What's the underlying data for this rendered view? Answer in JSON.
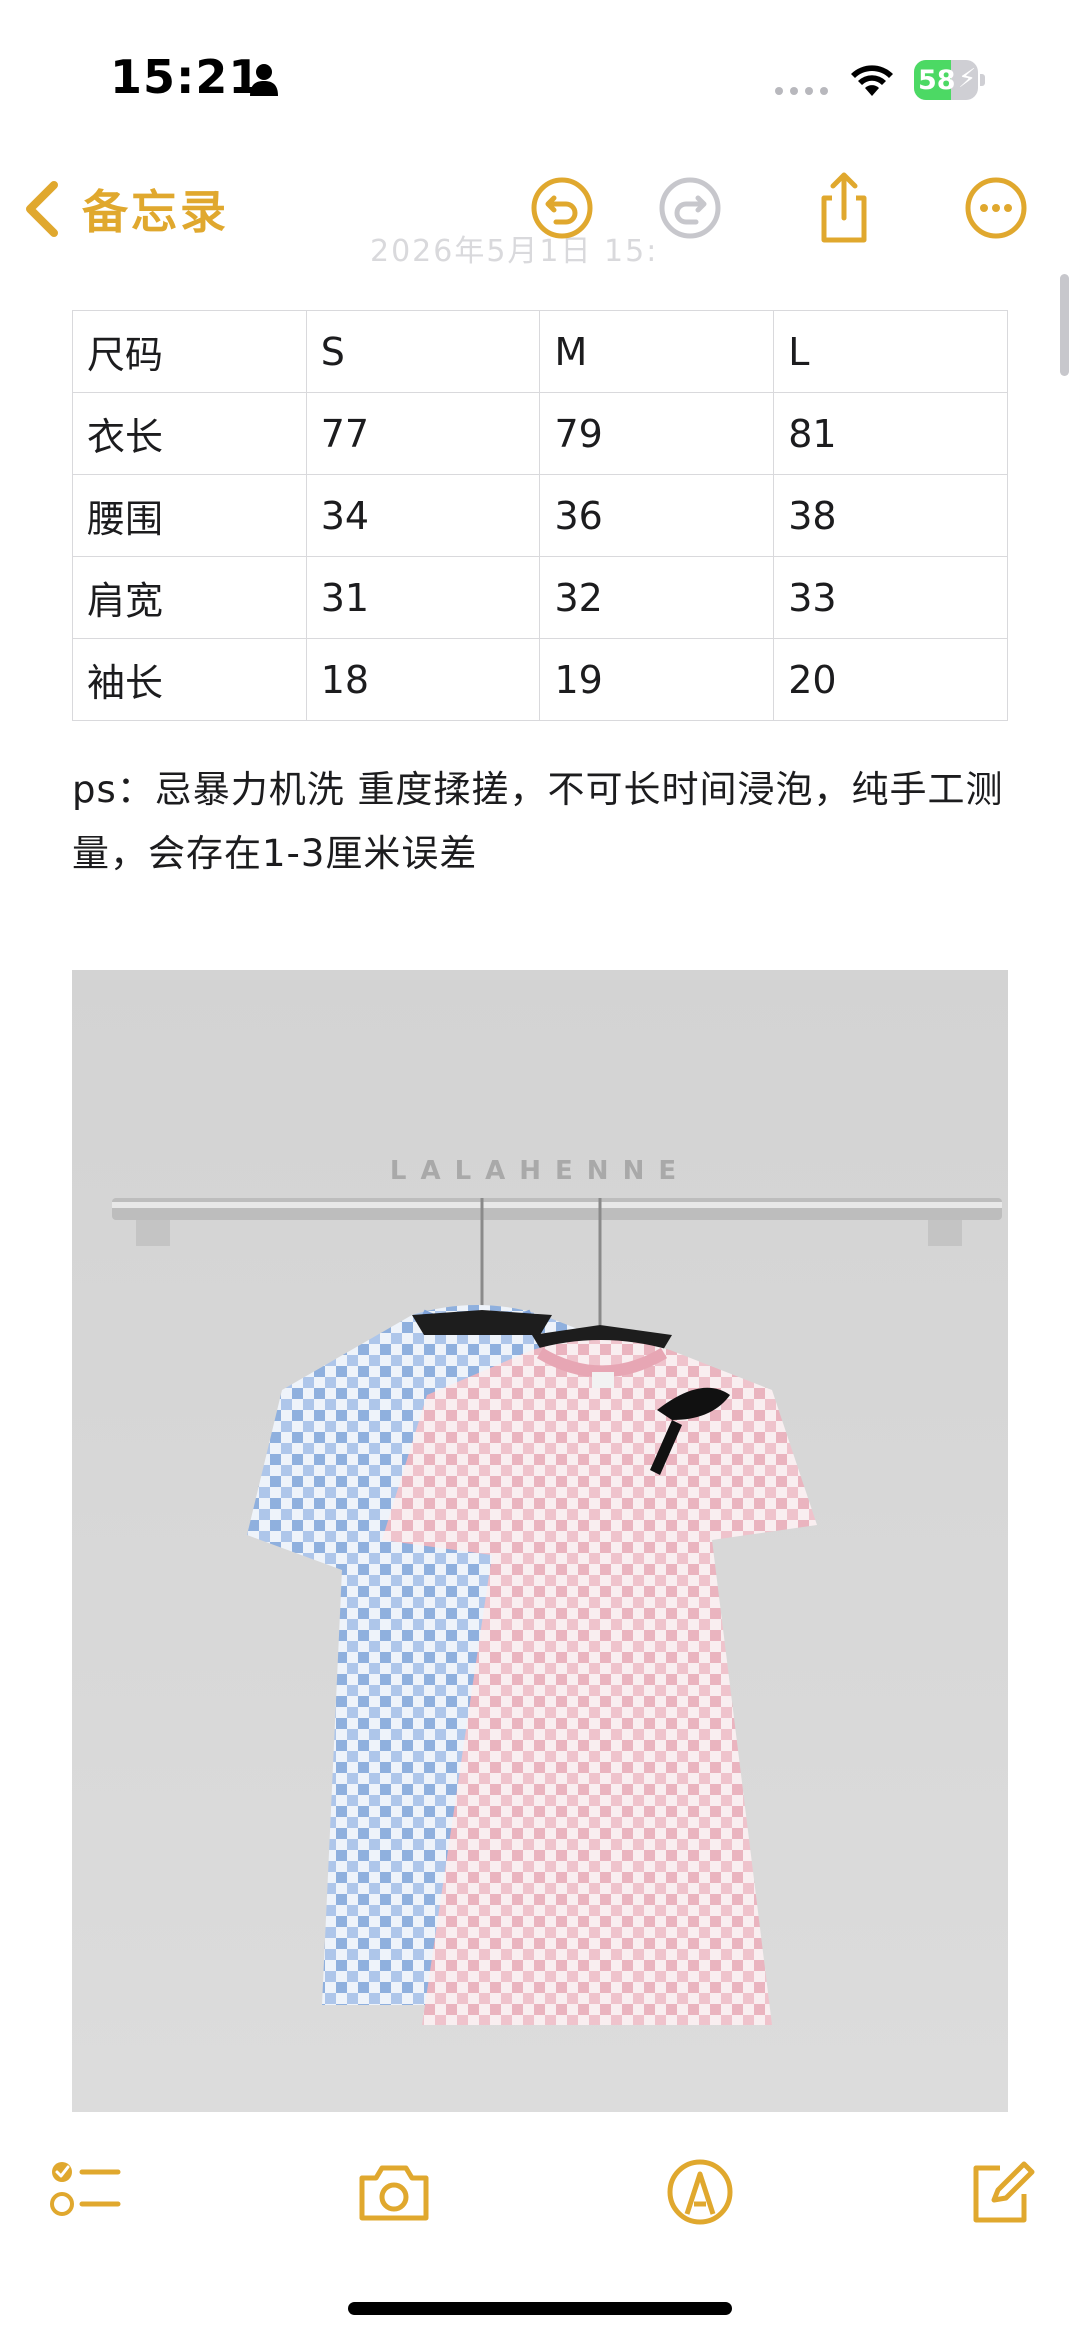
{
  "status_bar": {
    "time": "15:21",
    "battery_level": "58",
    "battery_fraction": 0.58
  },
  "nav": {
    "back_label": "备忘录",
    "faint_date": "2026年5月1日 15:",
    "icons": [
      "undo-icon",
      "redo-icon",
      "share-icon",
      "more-icon"
    ]
  },
  "table": {
    "rows": [
      [
        "尺码",
        "S",
        "M",
        "L"
      ],
      [
        "衣长",
        "77",
        "79",
        "81"
      ],
      [
        "腰围",
        "34",
        "36",
        "38"
      ],
      [
        "肩宽",
        "31",
        "32",
        "33"
      ],
      [
        "袖长",
        "18",
        "19",
        "20"
      ]
    ]
  },
  "note": {
    "text": "ps：忌暴力机洗 重度揉搓，不可长时间浸泡，纯手工测量，会存在1-3厘米误差"
  },
  "photo": {
    "watermark": "LALAHENNE"
  },
  "toolbar": {
    "icons": [
      "checklist-icon",
      "camera-icon",
      "markup-icon",
      "compose-icon"
    ]
  },
  "colors": {
    "accent": "#e0a82e",
    "battery_green": "#4cd964",
    "table_border": "#d9d9dc"
  }
}
